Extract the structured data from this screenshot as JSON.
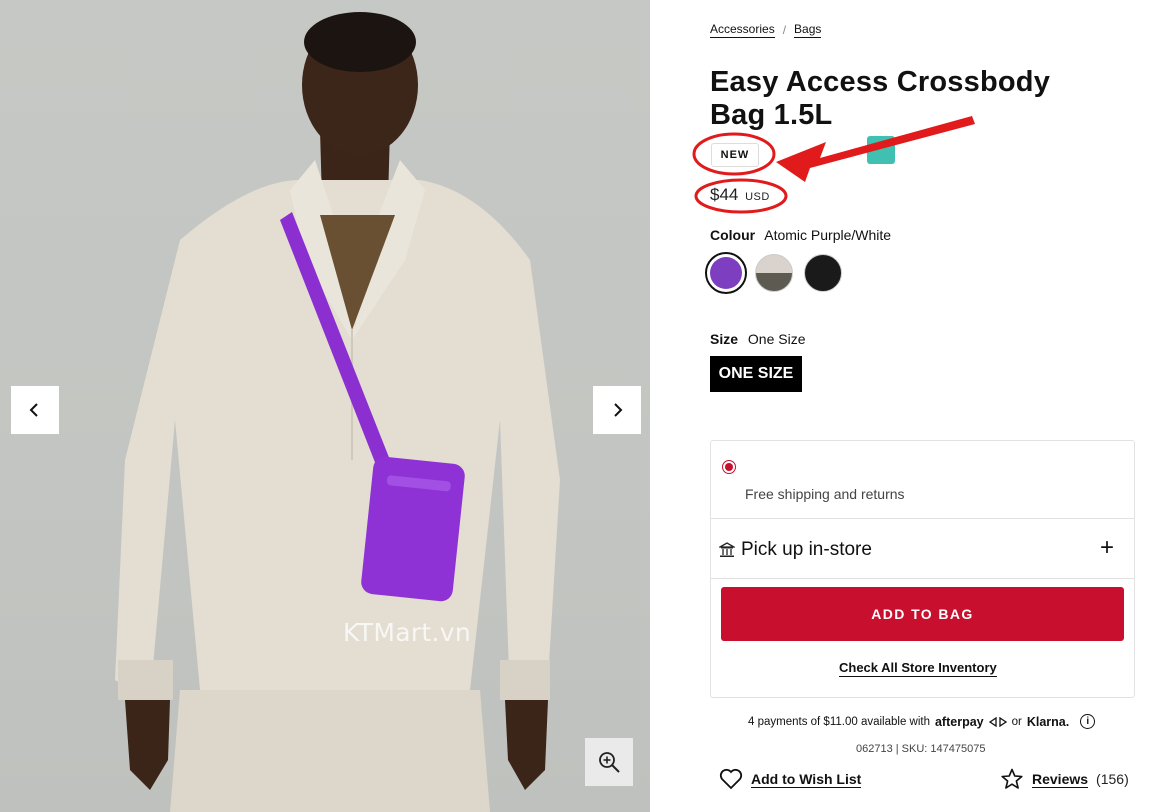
{
  "breadcrumb": [
    "Accessories",
    "Bags"
  ],
  "product": {
    "title": "Easy Access Crossbody Bag 1.5L",
    "badge": "NEW",
    "price": "$44",
    "currency": "USD"
  },
  "colour": {
    "label": "Colour",
    "selected": "Atomic Purple/White",
    "swatches": [
      {
        "name": "Atomic Purple/White",
        "color": "#7d3fbf"
      },
      {
        "name": "Bone/Olive",
        "color": "#d9d2cd"
      },
      {
        "name": "Black",
        "color": "#1a1a1a"
      }
    ]
  },
  "size": {
    "label": "Size",
    "selected": "One Size",
    "option": "ONE SIZE"
  },
  "shipping": {
    "free_text": "Free shipping and returns",
    "pickup_label": "Pick up in-store",
    "add_to_bag": "ADD TO BAG",
    "inventory_link": "Check All Store Inventory"
  },
  "payment": {
    "installments": "4 payments of $11.00 available with",
    "afterpay": "afterpay",
    "or": "or",
    "klarna": "Klarna."
  },
  "sku_text": "062713 | SKU: 147475075",
  "wishlist_label": "Add to Wish List",
  "reviews": {
    "label": "Reviews",
    "count": "(156)"
  },
  "watermark": "KTMart.vn",
  "colors": {
    "accent": "#c8102e",
    "annotation": "#e11b1b"
  }
}
